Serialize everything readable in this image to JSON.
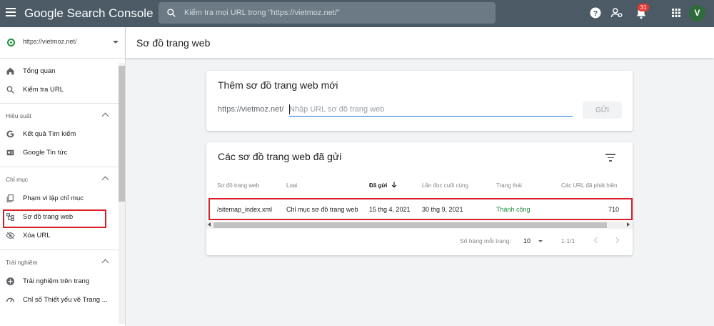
{
  "header": {
    "brand_google": "Google",
    "brand_product": "Search Console",
    "search_placeholder": "Kiểm tra mọi URL trong \"https://vietmoz.net/\"",
    "notification_count": "31",
    "avatar_letter": "V"
  },
  "sidebar": {
    "property": "https://vietmoz.net/",
    "items_top": [
      {
        "label": "Tổng quan",
        "icon": "home-icon"
      },
      {
        "label": "Kiểm tra URL",
        "icon": "search-icon"
      }
    ],
    "section_performance": "Hiệu suất",
    "items_performance": [
      {
        "label": "Kết quả Tìm kiếm",
        "icon": "google-g-icon"
      },
      {
        "label": "Google Tin tức",
        "icon": "news-icon"
      }
    ],
    "section_index": "Chỉ mục",
    "items_index": [
      {
        "label": "Phạm vi lập chỉ mục",
        "icon": "coverage-icon"
      },
      {
        "label": "Sơ đồ trang web",
        "icon": "sitemap-icon"
      },
      {
        "label": "Xóa URL",
        "icon": "hide-icon"
      }
    ],
    "section_experience": "Trải nghiệm",
    "items_experience": [
      {
        "label": "Trải nghiệm trên trang",
        "icon": "plus-circle-icon"
      },
      {
        "label": "Chỉ số Thiết yếu về Trang ...",
        "icon": "speed-icon"
      }
    ]
  },
  "main": {
    "page_title": "Sơ đồ trang web",
    "add_card": {
      "title": "Thêm sơ đồ trang web mới",
      "prefix": "https://vietmoz.net/",
      "input_placeholder": "Nhập URL sơ đồ trang web",
      "submit_label": "GỬI"
    },
    "submitted_card": {
      "title": "Các sơ đồ trang web đã gửi",
      "columns": [
        "Sơ đồ trang web",
        "Loại",
        "Đã gửi",
        "Lần đọc cuối cùng",
        "Trạng thái",
        "Các URL đã phát hiện"
      ],
      "rows": [
        {
          "sitemap": "/sitemap_index.xml",
          "type": "Chỉ mục sơ đồ trang web",
          "submitted": "15 thg 4, 2021",
          "last_read": "30 thg 9, 2021",
          "status": "Thành công",
          "discovered_urls": "710"
        }
      ],
      "pagination": {
        "rows_per_page_label": "Số hàng mỗi trang:",
        "rows_per_page": "10",
        "range": "1-1/1"
      }
    }
  },
  "colors": {
    "topbar": "#4b5a65",
    "accent": "#1a73e8",
    "success": "#1e8e3e",
    "highlight": "#d81e26"
  }
}
